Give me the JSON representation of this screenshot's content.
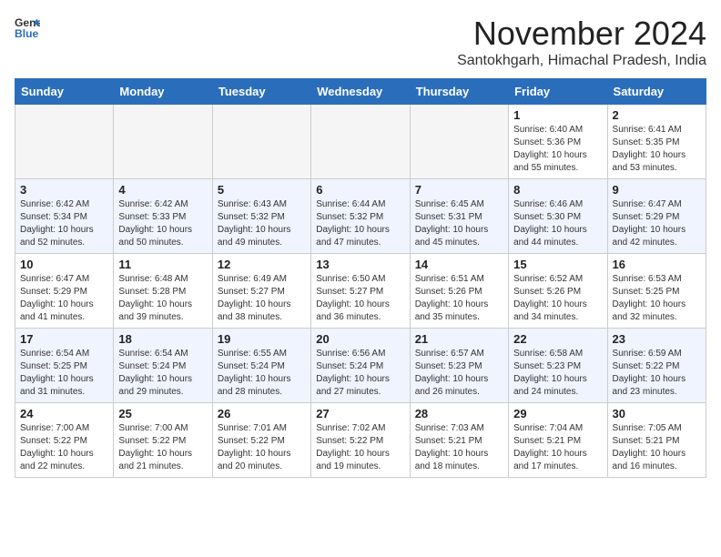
{
  "header": {
    "logo_general": "General",
    "logo_blue": "Blue",
    "title": "November 2024",
    "subtitle": "Santokhgarh, Himachal Pradesh, India"
  },
  "weekdays": [
    "Sunday",
    "Monday",
    "Tuesday",
    "Wednesday",
    "Thursday",
    "Friday",
    "Saturday"
  ],
  "weeks": [
    {
      "days": [
        {
          "num": "",
          "info": ""
        },
        {
          "num": "",
          "info": ""
        },
        {
          "num": "",
          "info": ""
        },
        {
          "num": "",
          "info": ""
        },
        {
          "num": "",
          "info": ""
        },
        {
          "num": "1",
          "info": "Sunrise: 6:40 AM\nSunset: 5:36 PM\nDaylight: 10 hours and 55 minutes."
        },
        {
          "num": "2",
          "info": "Sunrise: 6:41 AM\nSunset: 5:35 PM\nDaylight: 10 hours and 53 minutes."
        }
      ]
    },
    {
      "days": [
        {
          "num": "3",
          "info": "Sunrise: 6:42 AM\nSunset: 5:34 PM\nDaylight: 10 hours and 52 minutes."
        },
        {
          "num": "4",
          "info": "Sunrise: 6:42 AM\nSunset: 5:33 PM\nDaylight: 10 hours and 50 minutes."
        },
        {
          "num": "5",
          "info": "Sunrise: 6:43 AM\nSunset: 5:32 PM\nDaylight: 10 hours and 49 minutes."
        },
        {
          "num": "6",
          "info": "Sunrise: 6:44 AM\nSunset: 5:32 PM\nDaylight: 10 hours and 47 minutes."
        },
        {
          "num": "7",
          "info": "Sunrise: 6:45 AM\nSunset: 5:31 PM\nDaylight: 10 hours and 45 minutes."
        },
        {
          "num": "8",
          "info": "Sunrise: 6:46 AM\nSunset: 5:30 PM\nDaylight: 10 hours and 44 minutes."
        },
        {
          "num": "9",
          "info": "Sunrise: 6:47 AM\nSunset: 5:29 PM\nDaylight: 10 hours and 42 minutes."
        }
      ]
    },
    {
      "days": [
        {
          "num": "10",
          "info": "Sunrise: 6:47 AM\nSunset: 5:29 PM\nDaylight: 10 hours and 41 minutes."
        },
        {
          "num": "11",
          "info": "Sunrise: 6:48 AM\nSunset: 5:28 PM\nDaylight: 10 hours and 39 minutes."
        },
        {
          "num": "12",
          "info": "Sunrise: 6:49 AM\nSunset: 5:27 PM\nDaylight: 10 hours and 38 minutes."
        },
        {
          "num": "13",
          "info": "Sunrise: 6:50 AM\nSunset: 5:27 PM\nDaylight: 10 hours and 36 minutes."
        },
        {
          "num": "14",
          "info": "Sunrise: 6:51 AM\nSunset: 5:26 PM\nDaylight: 10 hours and 35 minutes."
        },
        {
          "num": "15",
          "info": "Sunrise: 6:52 AM\nSunset: 5:26 PM\nDaylight: 10 hours and 34 minutes."
        },
        {
          "num": "16",
          "info": "Sunrise: 6:53 AM\nSunset: 5:25 PM\nDaylight: 10 hours and 32 minutes."
        }
      ]
    },
    {
      "days": [
        {
          "num": "17",
          "info": "Sunrise: 6:54 AM\nSunset: 5:25 PM\nDaylight: 10 hours and 31 minutes."
        },
        {
          "num": "18",
          "info": "Sunrise: 6:54 AM\nSunset: 5:24 PM\nDaylight: 10 hours and 29 minutes."
        },
        {
          "num": "19",
          "info": "Sunrise: 6:55 AM\nSunset: 5:24 PM\nDaylight: 10 hours and 28 minutes."
        },
        {
          "num": "20",
          "info": "Sunrise: 6:56 AM\nSunset: 5:24 PM\nDaylight: 10 hours and 27 minutes."
        },
        {
          "num": "21",
          "info": "Sunrise: 6:57 AM\nSunset: 5:23 PM\nDaylight: 10 hours and 26 minutes."
        },
        {
          "num": "22",
          "info": "Sunrise: 6:58 AM\nSunset: 5:23 PM\nDaylight: 10 hours and 24 minutes."
        },
        {
          "num": "23",
          "info": "Sunrise: 6:59 AM\nSunset: 5:22 PM\nDaylight: 10 hours and 23 minutes."
        }
      ]
    },
    {
      "days": [
        {
          "num": "24",
          "info": "Sunrise: 7:00 AM\nSunset: 5:22 PM\nDaylight: 10 hours and 22 minutes."
        },
        {
          "num": "25",
          "info": "Sunrise: 7:00 AM\nSunset: 5:22 PM\nDaylight: 10 hours and 21 minutes."
        },
        {
          "num": "26",
          "info": "Sunrise: 7:01 AM\nSunset: 5:22 PM\nDaylight: 10 hours and 20 minutes."
        },
        {
          "num": "27",
          "info": "Sunrise: 7:02 AM\nSunset: 5:22 PM\nDaylight: 10 hours and 19 minutes."
        },
        {
          "num": "28",
          "info": "Sunrise: 7:03 AM\nSunset: 5:21 PM\nDaylight: 10 hours and 18 minutes."
        },
        {
          "num": "29",
          "info": "Sunrise: 7:04 AM\nSunset: 5:21 PM\nDaylight: 10 hours and 17 minutes."
        },
        {
          "num": "30",
          "info": "Sunrise: 7:05 AM\nSunset: 5:21 PM\nDaylight: 10 hours and 16 minutes."
        }
      ]
    }
  ]
}
